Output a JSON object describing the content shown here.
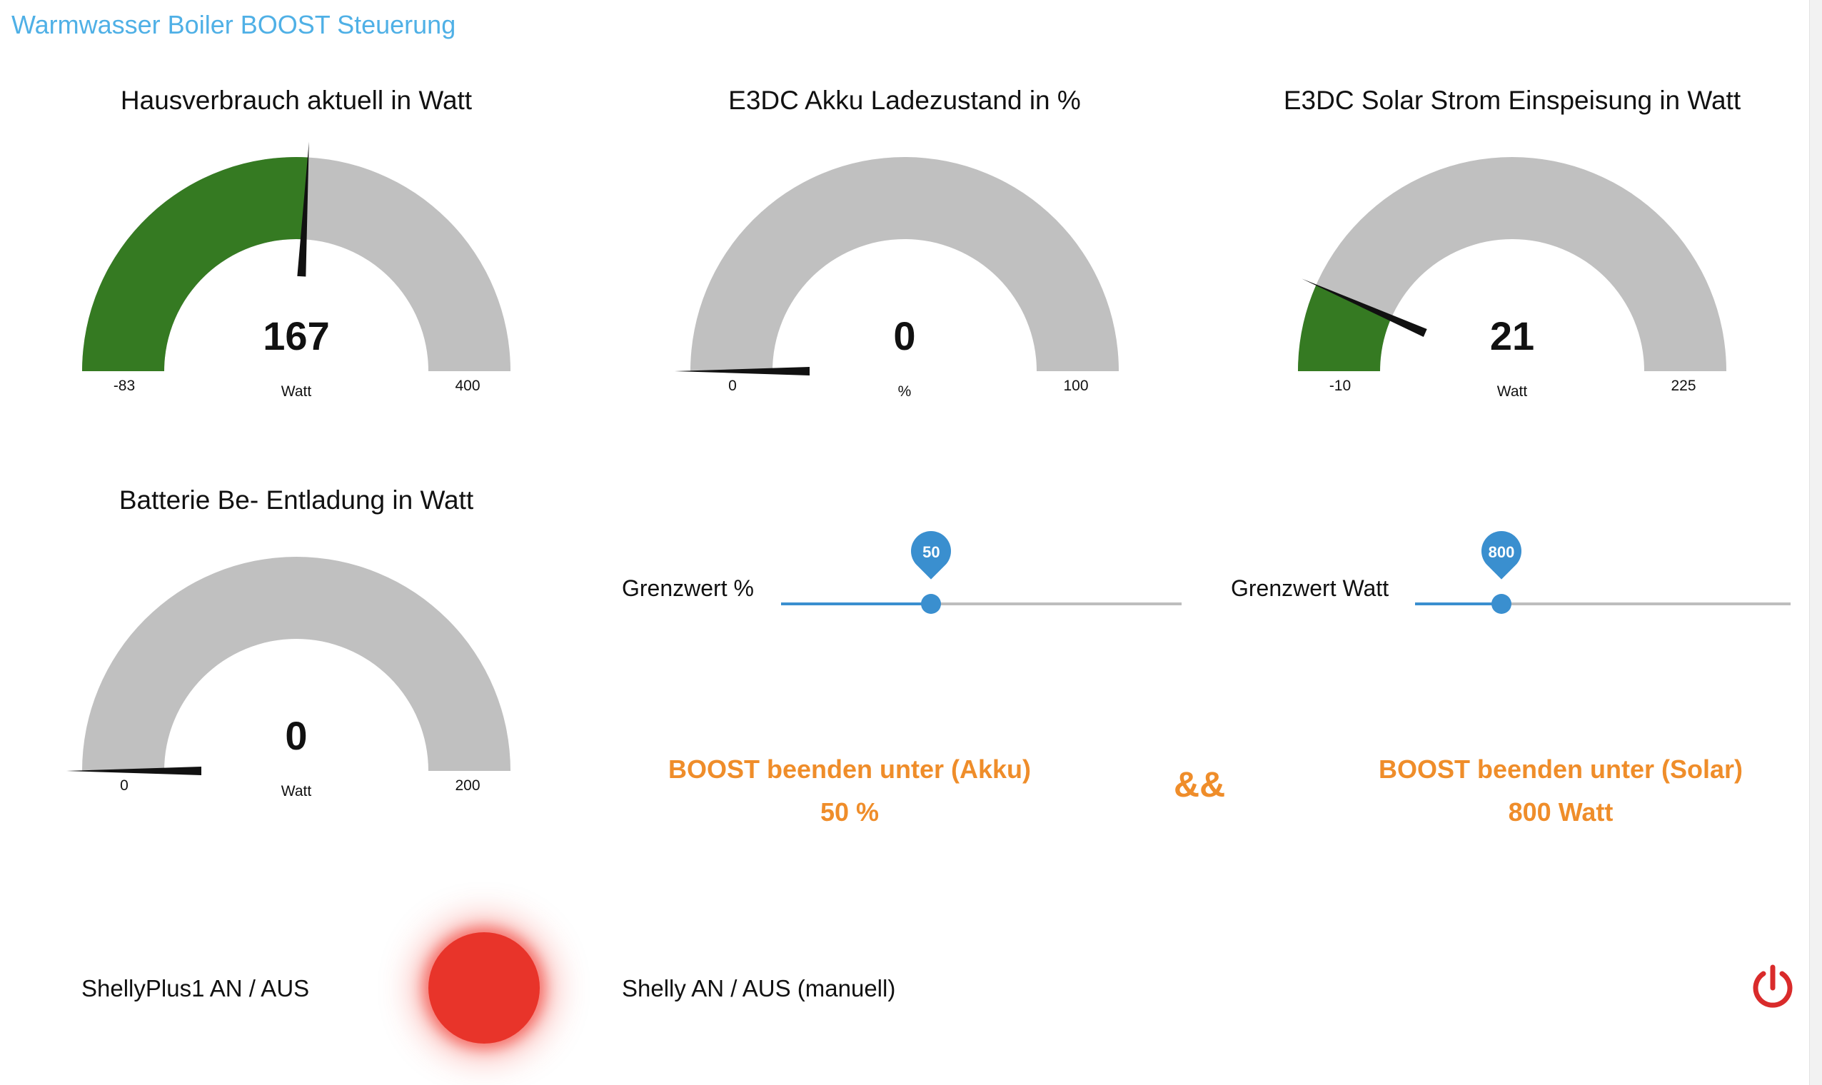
{
  "app": {
    "title": "Warmwasser Boiler BOOST Steuerung"
  },
  "gauges": [
    {
      "title": "Hausverbrauch aktuell in Watt",
      "value": 167,
      "display": "167",
      "unit": "Watt",
      "min": -83,
      "max": 400,
      "min_label": "-83",
      "max_label": "400",
      "fill_color": "#357a22",
      "track_color": "#c0c0c0",
      "needle_color": "#111111"
    },
    {
      "title": "E3DC Akku Ladezustand in %",
      "value": 0,
      "display": "0",
      "unit": "%",
      "min": 0,
      "max": 100,
      "min_label": "0",
      "max_label": "100",
      "fill_color": "#357a22",
      "track_color": "#c0c0c0",
      "needle_color": "#111111"
    },
    {
      "title": "E3DC Solar Strom Einspeisung in Watt",
      "value": 21,
      "display": "21",
      "unit": "Watt",
      "min": -10,
      "max": 225,
      "min_label": "-10",
      "max_label": "225",
      "fill_color": "#357a22",
      "track_color": "#c0c0c0",
      "needle_color": "#111111"
    },
    {
      "title": "Batterie Be- Entladung in Watt",
      "value": 0,
      "display": "0",
      "unit": "Watt",
      "min": 0,
      "max": 200,
      "min_label": "0",
      "max_label": "200",
      "fill_color": "#357a22",
      "track_color": "#c0c0c0",
      "needle_color": "#111111"
    }
  ],
  "sliders": [
    {
      "label": "Grenzwert %",
      "value": 50,
      "value_label": "50",
      "fraction": 0.375
    },
    {
      "label": "Grenzwert Watt",
      "value": 800,
      "value_label": "800",
      "fraction": 0.23
    }
  ],
  "boost": {
    "akku_title": "BOOST beenden unter (Akku)",
    "akku_value": "50 %",
    "and_symbol": "&&",
    "solar_title": "BOOST beenden unter (Solar)",
    "solar_value": "800 Watt"
  },
  "switches": {
    "shelly_label": "ShellyPlus1 AN / AUS",
    "shelly_status_color": "#e8342a",
    "manual_label": "Shelly AN / AUS (manuell)",
    "power_icon": "power-icon",
    "power_color": "#d92b2b"
  },
  "colors": {
    "title": "#4fb0e6",
    "accent": "#3a8fcf",
    "boost": "#ef8d2a"
  }
}
